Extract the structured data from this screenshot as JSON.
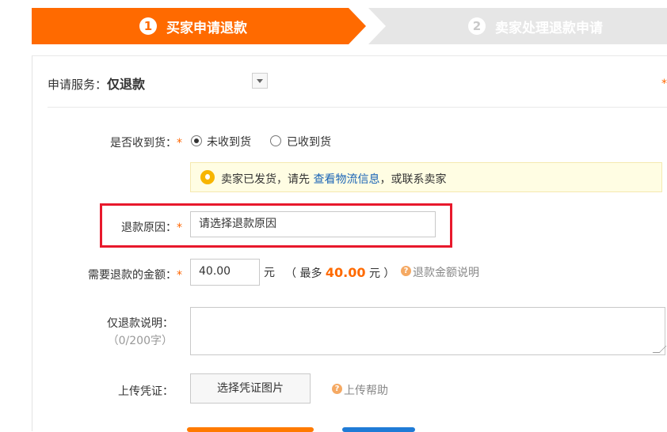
{
  "steps": [
    {
      "num": "1",
      "label": "买家申请退款",
      "active": true
    },
    {
      "num": "2",
      "label": "卖家处理退款申请",
      "active": false
    }
  ],
  "service": {
    "label": "申请服务：",
    "value": "仅退款"
  },
  "right_star": "*",
  "received": {
    "label": "是否收到货：",
    "required": "*",
    "options": [
      {
        "label": "未收到货",
        "checked": true
      },
      {
        "label": "已收到货",
        "checked": false
      }
    ]
  },
  "notice": {
    "prefix": "卖家已发货，请先 ",
    "link": "查看物流信息",
    "suffix": "，或联系卖家"
  },
  "reason": {
    "label": "退款原因：",
    "required": "*",
    "placeholder": "请选择退款原因"
  },
  "amount": {
    "label": "需要退款的金额：",
    "required": "*",
    "value": "40.00",
    "unit": "元",
    "max_open": "（ 最多 ",
    "max_value": "40.00",
    "max_close": " 元 ）",
    "help_icon": "?",
    "help": "退款金额说明"
  },
  "desc": {
    "label": "仅退款说明：",
    "counter": "（0/200字）"
  },
  "proof": {
    "label": "上传凭证：",
    "button": "选择凭证图片",
    "help_icon": "?",
    "help": "上传帮助"
  },
  "colors": {
    "accent": "#ff6a00",
    "link": "#1a64b6",
    "highlight": "#e8192c"
  }
}
